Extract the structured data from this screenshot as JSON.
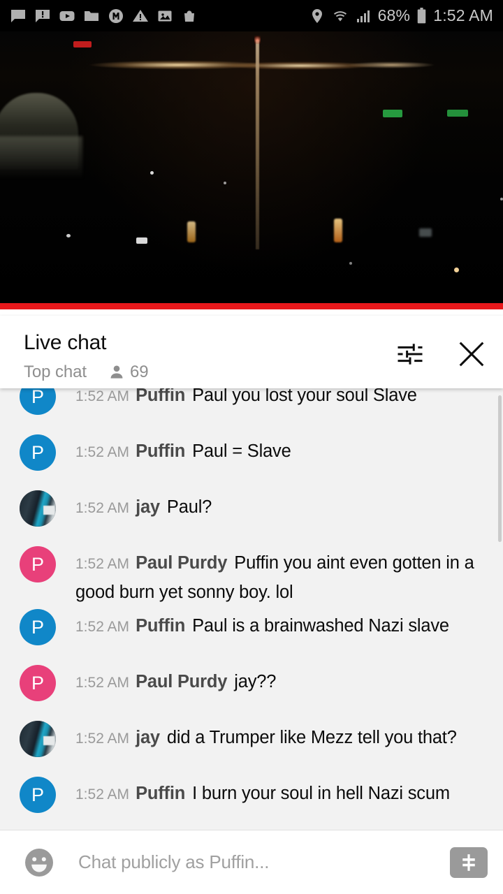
{
  "status_bar": {
    "left_icons": [
      "chat-bubble-icon",
      "chat-alert-icon",
      "youtube-icon",
      "folder-icon",
      "m-circle-icon",
      "warning-triangle-icon",
      "photo-icon",
      "shopping-bag-icon"
    ],
    "right_icons": [
      "location-pin-icon",
      "wifi-icon",
      "cell-signal-icon",
      "battery-icon"
    ],
    "battery_text": "68%",
    "clock": "1:52 AM"
  },
  "video": {
    "name": "live-stream-video",
    "description": "night cityscape live stream",
    "progress_color": "#e8181b",
    "progress_percent": 100
  },
  "chat_header": {
    "title": "Live chat",
    "mode": "Top chat",
    "viewer_count": "69",
    "viewers_icon": "person-icon",
    "tune_icon": "tune-icon",
    "close_icon": "close-icon"
  },
  "chat": {
    "messages": [
      {
        "timestamp": "1:52 AM",
        "author": "Puffin",
        "text": "Paul you lost your soul Slave",
        "avatar_type": "letter",
        "avatar_letter": "P",
        "avatar_color": "#1087c8"
      },
      {
        "timestamp": "1:52 AM",
        "author": "Puffin",
        "text": "Paul = Slave",
        "avatar_type": "letter",
        "avatar_letter": "P",
        "avatar_color": "#1087c8"
      },
      {
        "timestamp": "1:52 AM",
        "author": "jay",
        "text": "Paul?",
        "avatar_type": "photo",
        "avatar_letter": "",
        "avatar_color": "#2c3b45"
      },
      {
        "timestamp": "1:52 AM",
        "author": "Paul Purdy",
        "text": "Puffin you aint even gotten in a good burn yet sonny boy. lol",
        "avatar_type": "letter",
        "avatar_letter": "P",
        "avatar_color": "#e8407a"
      },
      {
        "timestamp": "1:52 AM",
        "author": "Puffin",
        "text": "Paul is a brainwashed Nazi slave",
        "avatar_type": "letter",
        "avatar_letter": "P",
        "avatar_color": "#1087c8"
      },
      {
        "timestamp": "1:52 AM",
        "author": "Paul Purdy",
        "text": "jay??",
        "avatar_type": "letter",
        "avatar_letter": "P",
        "avatar_color": "#e8407a"
      },
      {
        "timestamp": "1:52 AM",
        "author": "jay",
        "text": "did a Trumper like Mezz tell you that?",
        "avatar_type": "photo",
        "avatar_letter": "",
        "avatar_color": "#2c3b45"
      },
      {
        "timestamp": "1:52 AM",
        "author": "Puffin",
        "text": "I burn your soul in hell Nazi scum",
        "avatar_type": "letter",
        "avatar_letter": "P",
        "avatar_color": "#1087c8"
      }
    ]
  },
  "input_bar": {
    "emoji_icon": "emoji-smiley-icon",
    "placeholder": "Chat publicly as Puffin...",
    "value": "",
    "superchat_icon": "dollar-sign-icon"
  }
}
